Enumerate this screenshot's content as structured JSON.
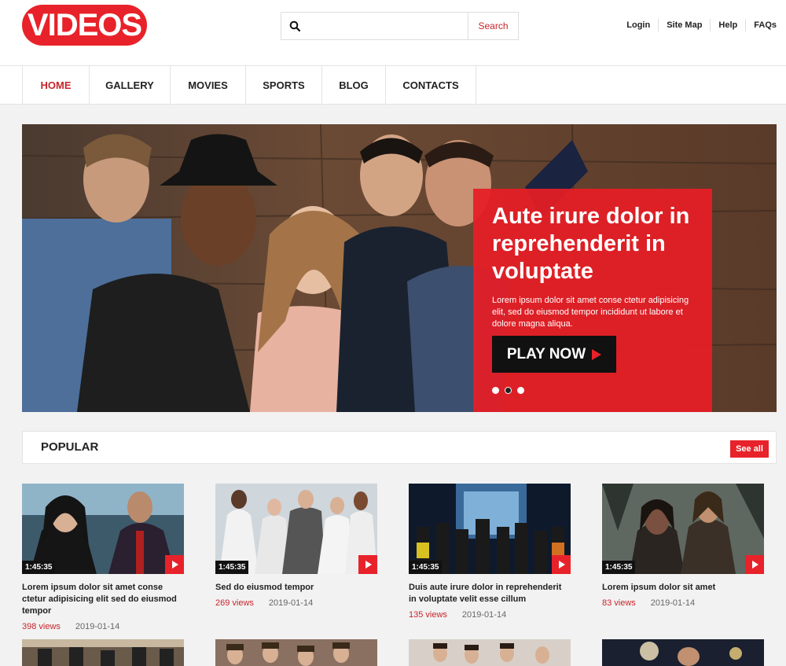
{
  "brand": {
    "logo_text": "VIDEOS",
    "accent": "#e8222a"
  },
  "search": {
    "placeholder": "",
    "button_label": "Search"
  },
  "top_links": [
    "Login",
    "Site Map",
    "Help",
    "FAQs"
  ],
  "nav": {
    "items": [
      {
        "label": "HOME",
        "active": true
      },
      {
        "label": "GALLERY"
      },
      {
        "label": "MOVIES"
      },
      {
        "label": "SPORTS"
      },
      {
        "label": "BLOG"
      },
      {
        "label": "CONTACTS"
      }
    ]
  },
  "hero": {
    "heading": "Aute irure dolor in reprehenderit in voluptate",
    "text": "Lorem ipsum dolor sit amet conse ctetur adipisicing elit, sed do eiusmod tempor incididunt ut labore et dolore magna aliqua.",
    "button_label": "PLAY NOW",
    "slides": 3,
    "active_slide": 2
  },
  "popular": {
    "title": "POPULAR",
    "see_all_label": "See all",
    "videos": [
      {
        "duration": "1:45:35",
        "title": "Lorem ipsum dolor sit amet conse ctetur adipisicing elit sed do eiusmod tempor",
        "views": "398 views",
        "date": "2019-01-14"
      },
      {
        "duration": "1:45:35",
        "title": "Sed do eiusmod tempor",
        "views": "269 views",
        "date": "2019-01-14"
      },
      {
        "duration": "1:45:35",
        "title": "Duis aute irure dolor in reprehenderit in voluptate velit esse cillum",
        "views": "135 views",
        "date": "2019-01-14"
      },
      {
        "duration": "1:45:35",
        "title": "Lorem ipsum dolor sit amet",
        "views": "83 views",
        "date": "2019-01-14"
      }
    ]
  }
}
